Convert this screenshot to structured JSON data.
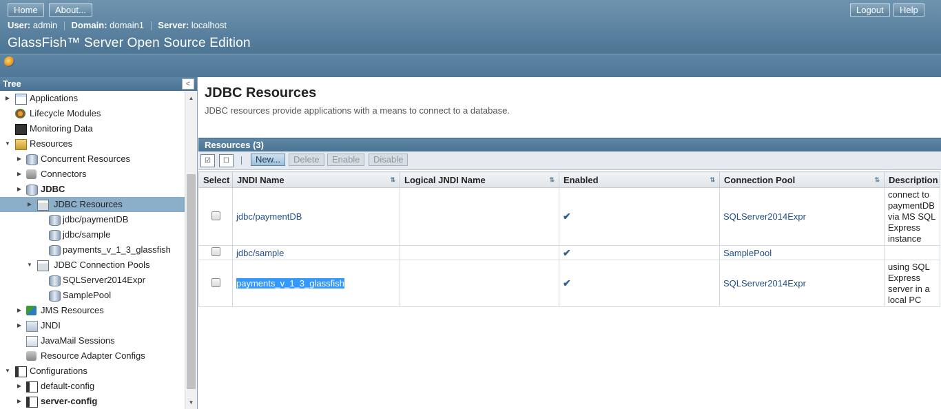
{
  "masthead": {
    "home_label": "Home",
    "about_label": "About...",
    "logout_label": "Logout",
    "help_label": "Help",
    "user_key": "User:",
    "user_value": "admin",
    "domain_key": "Domain:",
    "domain_value": "domain1",
    "server_key": "Server:",
    "server_value": "localhost",
    "product_name": "GlassFish™ Server Open Source Edition"
  },
  "tree": {
    "header": "Tree",
    "collapse_glyph": "<",
    "items": [
      {
        "label": "Applications",
        "icon": "applications-icon"
      },
      {
        "label": "Lifecycle Modules",
        "icon": "lifecycle-icon"
      },
      {
        "label": "Monitoring Data",
        "icon": "monitor-icon"
      },
      {
        "label": "Resources",
        "icon": "resources-icon"
      },
      {
        "label": "Concurrent Resources",
        "icon": "database-icon"
      },
      {
        "label": "Connectors",
        "icon": "connector-icon"
      },
      {
        "label": "JDBC",
        "icon": "database-icon"
      },
      {
        "label": "JDBC Resources",
        "icon": "folder-icon"
      },
      {
        "label": "jdbc/paymentDB",
        "icon": "database-icon"
      },
      {
        "label": "jdbc/sample",
        "icon": "database-icon"
      },
      {
        "label": "payments_v_1_3_glassfish",
        "icon": "database-icon"
      },
      {
        "label": "JDBC Connection Pools",
        "icon": "folder-icon"
      },
      {
        "label": "SQLServer2014Expr",
        "icon": "database-icon"
      },
      {
        "label": "SamplePool",
        "icon": "database-icon"
      },
      {
        "label": "JMS Resources",
        "icon": "jms-icon"
      },
      {
        "label": "JNDI",
        "icon": "jndi-icon"
      },
      {
        "label": "JavaMail Sessions",
        "icon": "mail-icon"
      },
      {
        "label": "Resource Adapter Configs",
        "icon": "connector-icon"
      },
      {
        "label": "Configurations",
        "icon": "config-icon"
      },
      {
        "label": "default-config",
        "icon": "config-icon"
      },
      {
        "label": "server-config",
        "icon": "config-icon"
      }
    ]
  },
  "page": {
    "title": "JDBC Resources",
    "help_text": "JDBC resources provide applications with a means to connect to a database."
  },
  "resources_table": {
    "title": "Resources (3)",
    "actions": {
      "new": "New...",
      "delete": "Delete",
      "enable": "Enable",
      "disable": "Disable"
    },
    "columns": {
      "select": "Select",
      "jndi_name": "JNDI Name",
      "logical_jndi_name": "Logical JNDI Name",
      "enabled": "Enabled",
      "connection_pool": "Connection Pool",
      "description": "Description"
    },
    "rows": [
      {
        "jndi_name": "jdbc/paymentDB",
        "logical_jndi_name": "",
        "enabled": "✔",
        "connection_pool": "SQLServer2014Expr",
        "description": "connect to paymentDB via MS SQL Express instance"
      },
      {
        "jndi_name": "jdbc/sample",
        "logical_jndi_name": "",
        "enabled": "✔",
        "connection_pool": "SamplePool",
        "description": ""
      },
      {
        "jndi_name": "payments_v_1_3_glassfish",
        "logical_jndi_name": "",
        "enabled": "✔",
        "connection_pool": "SQLServer2014Expr",
        "description": "using SQL Express server in a local PC"
      }
    ]
  },
  "colors": {
    "masthead": "#5a82a1",
    "tree_selected": "#8cafc9",
    "link": "#22508a",
    "highlight": "#3399ff"
  }
}
